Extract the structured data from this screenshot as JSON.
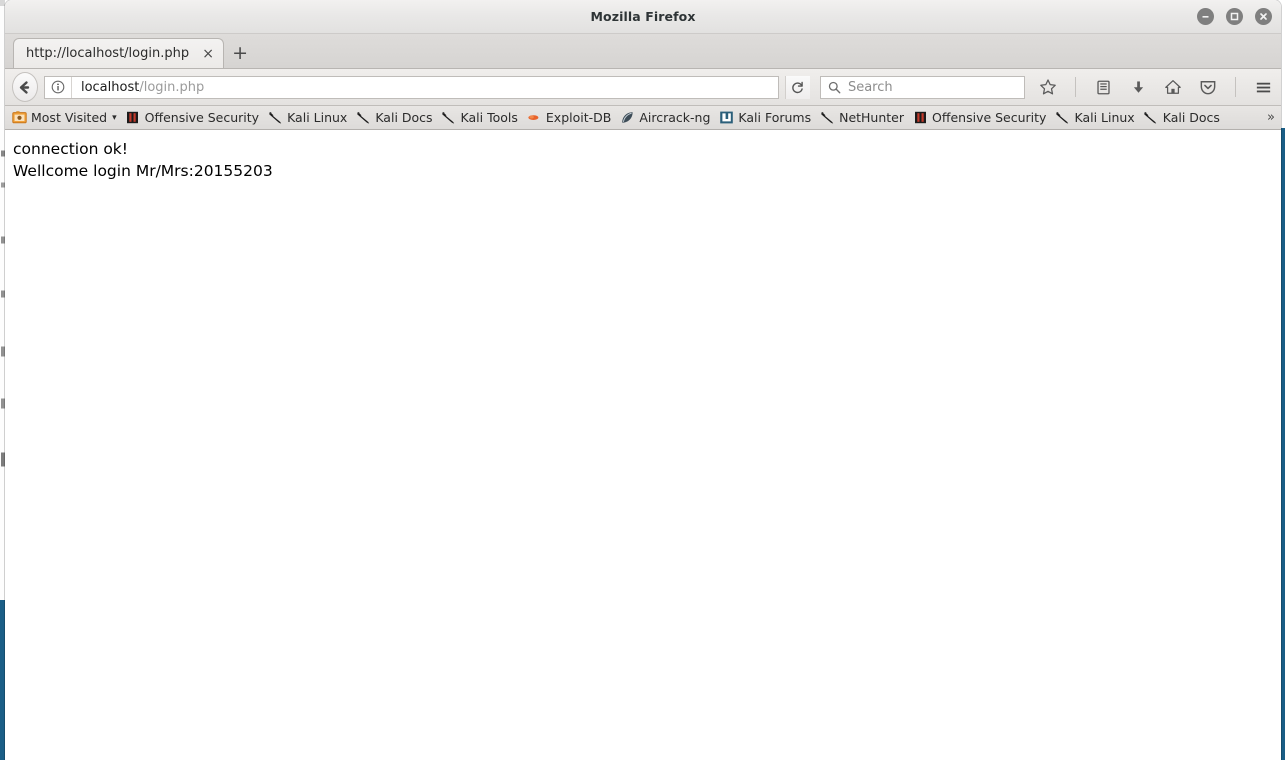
{
  "window": {
    "title": "Mozilla Firefox",
    "controls": [
      {
        "name": "minimize",
        "glyph": "minimize-icon"
      },
      {
        "name": "maximize",
        "glyph": "maximize-icon"
      },
      {
        "name": "close",
        "glyph": "close-icon"
      }
    ]
  },
  "tabs": {
    "items": [
      {
        "label": "http://localhost/login.php",
        "close_label": "×",
        "active": true
      }
    ],
    "new_tab_label": "+"
  },
  "navbar": {
    "back_icon": "back-arrow-icon",
    "identity_icon": "info-icon",
    "url_host": "localhost",
    "url_path": "/login.php",
    "reload_icon": "reload-icon",
    "search_placeholder": "Search",
    "search_value": "",
    "icons": [
      {
        "name": "bookmark-star-icon"
      },
      {
        "name": "library-icon"
      },
      {
        "name": "downloads-icon"
      },
      {
        "name": "home-icon"
      },
      {
        "name": "pocket-icon"
      },
      {
        "name": "menu-hamburger-icon"
      }
    ]
  },
  "bookmarks": {
    "overflow_label": "»",
    "items": [
      {
        "label": "Most Visited",
        "icon": "most-visited-folder-icon",
        "chevron": "▾"
      },
      {
        "label": "Offensive Security",
        "icon": "offensive-security-icon"
      },
      {
        "label": "Kali Linux",
        "icon": "kali-dragon-icon"
      },
      {
        "label": "Kali Docs",
        "icon": "kali-dragon-icon"
      },
      {
        "label": "Kali Tools",
        "icon": "kali-dragon-icon"
      },
      {
        "label": "Exploit-DB",
        "icon": "exploit-db-icon"
      },
      {
        "label": "Aircrack-ng",
        "icon": "aircrack-ng-icon"
      },
      {
        "label": "Kali Forums",
        "icon": "kali-forums-icon"
      },
      {
        "label": "NetHunter",
        "icon": "kali-dragon-icon"
      },
      {
        "label": "Offensive Security",
        "icon": "offensive-security-icon"
      },
      {
        "label": "Kali Linux",
        "icon": "kali-dragon-icon"
      },
      {
        "label": "Kali Docs",
        "icon": "kali-dragon-icon"
      }
    ]
  },
  "page": {
    "lines": [
      "connection ok!",
      "Wellcome login Mr/Mrs:20155203"
    ]
  },
  "colors": {
    "accent_blue": "#1a5e86",
    "toolbar_bg": "#e4e2e0",
    "titlebar_bg": "#e9e8e7",
    "text": "#2b2b2b"
  }
}
